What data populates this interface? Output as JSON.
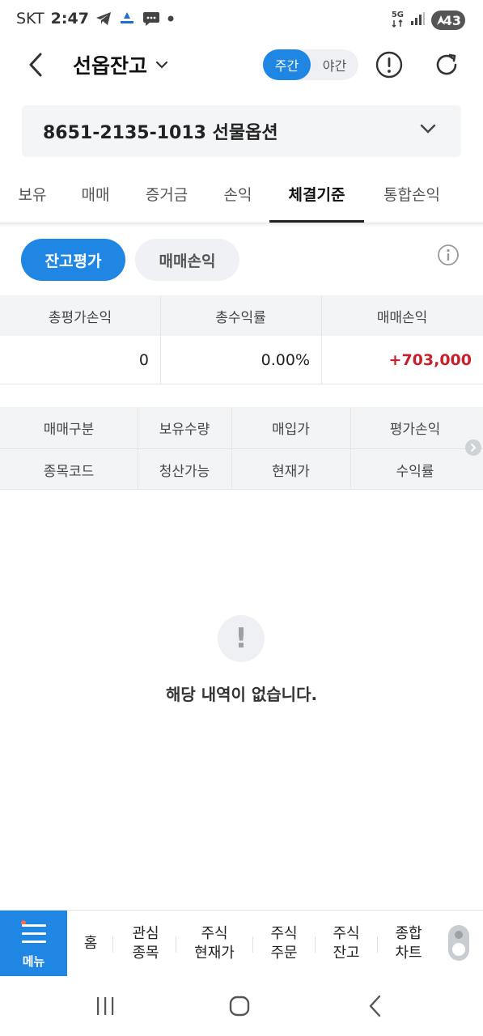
{
  "status_bar": {
    "carrier": "SKT",
    "time": "2:47",
    "network": "5G",
    "battery": "43"
  },
  "header": {
    "title": "선옵잔고",
    "session_day": "주간",
    "session_night": "야간"
  },
  "account": {
    "label": "8651-2135-1013 선물옵션"
  },
  "tabs": [
    {
      "label": "보유"
    },
    {
      "label": "매매"
    },
    {
      "label": "증거금"
    },
    {
      "label": "손익"
    },
    {
      "label": "체결기준",
      "active": true
    },
    {
      "label": "통합손익"
    }
  ],
  "segment": {
    "active": "잔고평가",
    "inactive": "매매손익"
  },
  "summary": {
    "headers": [
      "총평가손익",
      "총수익률",
      "매매손익"
    ],
    "values": [
      "0",
      "0.00%",
      "+703,000"
    ]
  },
  "list_header": {
    "row1": [
      "매매구분",
      "보유수량",
      "매입가",
      "평가손익"
    ],
    "row2": [
      "종목코드",
      "청산가능",
      "현재가",
      "수익률"
    ]
  },
  "empty_state": {
    "message": "해당 내역이 없습니다."
  },
  "bottom_menu": {
    "menu_label": "메뉴",
    "items": [
      "홈",
      "관심\n종목",
      "주식\n현재가",
      "주식\n주문",
      "주식\n잔고",
      "종합\n차트"
    ]
  },
  "colors": {
    "accent": "#1f86e3",
    "profit": "#c8202a"
  }
}
